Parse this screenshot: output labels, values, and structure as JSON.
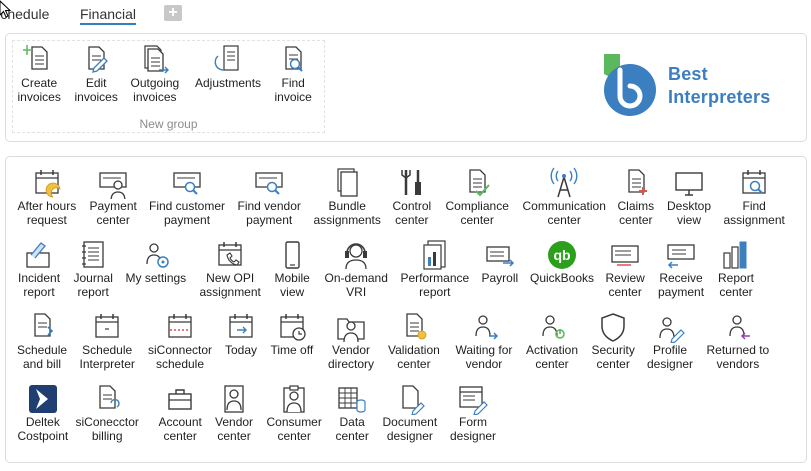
{
  "tabs": [
    {
      "label": "Schedule",
      "active": false
    },
    {
      "label": "Financial",
      "active": true
    }
  ],
  "add_tab_label": "+",
  "logo": {
    "line1": "Best",
    "line2": "Interpreters",
    "green": "#5cb85c",
    "blue": "#3b7fc1"
  },
  "group1": {
    "name": "New group",
    "items": [
      {
        "label": "Create\ninvoices",
        "icon": "create-invoice-icon"
      },
      {
        "label": "Edit\ninvoices",
        "icon": "edit-invoice-icon"
      },
      {
        "label": "Outgoing\ninvoices",
        "icon": "outgoing-invoices-icon"
      },
      {
        "label": "Adjustments",
        "icon": "adjustments-icon"
      },
      {
        "label": "Find\ninvoice",
        "icon": "find-invoice-icon"
      }
    ]
  },
  "main": {
    "rows": [
      [
        {
          "label": "After hours\nrequest",
          "icon": "after-hours-icon"
        },
        {
          "label": "Payment\ncenter",
          "icon": "payment-center-icon"
        },
        {
          "label": "Find customer\npayment",
          "icon": "find-customer-payment-icon"
        },
        {
          "label": "Find vendor\npayment",
          "icon": "find-vendor-payment-icon"
        },
        {
          "label": "Bundle\nassignments",
          "icon": "bundle-icon"
        },
        {
          "label": "Control\ncenter",
          "icon": "tools-icon"
        },
        {
          "label": "Compliance\ncenter",
          "icon": "compliance-icon"
        },
        {
          "label": "Communication\ncenter",
          "icon": "antenna-icon"
        },
        {
          "label": "Claims\ncenter",
          "icon": "claims-icon"
        },
        {
          "label": "Desktop\nview",
          "icon": "monitor-icon"
        },
        {
          "label": "Find\nassignment",
          "icon": "find-assignment-icon"
        }
      ],
      [
        {
          "label": "Incident\nreport",
          "icon": "incident-icon"
        },
        {
          "label": "Journal\nreport",
          "icon": "journal-icon"
        },
        {
          "label": "My settings",
          "icon": "user-settings-icon"
        },
        {
          "label": "New OPI\nassignment",
          "icon": "new-opi-icon"
        },
        {
          "label": "Mobile\nview",
          "icon": "mobile-icon"
        },
        {
          "label": "On-demand\nVRI",
          "icon": "headset-icon"
        },
        {
          "label": "Performance\nreport",
          "icon": "performance-icon"
        },
        {
          "label": "Payroll",
          "icon": "payroll-icon"
        },
        {
          "label": "QuickBooks",
          "icon": "quickbooks-icon"
        },
        {
          "label": "Review\ncenter",
          "icon": "review-icon"
        },
        {
          "label": "Receive\npayment",
          "icon": "receive-payment-icon"
        },
        {
          "label": "Report\ncenter",
          "icon": "report-chart-icon"
        }
      ],
      [
        {
          "label": "Schedule\nand bill",
          "icon": "schedule-bill-icon"
        },
        {
          "label": "Schedule\nInterpreter",
          "icon": "schedule-interpreter-icon"
        },
        {
          "label": "siConnector\nschedule",
          "icon": "siconnector-schedule-icon"
        },
        {
          "label": "Today",
          "icon": "today-icon"
        },
        {
          "label": "Time off",
          "icon": "time-off-icon"
        },
        {
          "label": "Vendor\ndirectory",
          "icon": "vendor-directory-icon"
        },
        {
          "label": "Validation\ncenter",
          "icon": "validation-icon"
        },
        {
          "label": "Waiting for\nvendor",
          "icon": "waiting-vendor-icon"
        },
        {
          "label": "Activation\ncenter",
          "icon": "activation-icon"
        },
        {
          "label": "Security\ncenter",
          "icon": "shield-icon"
        },
        {
          "label": "Profile\ndesigner",
          "icon": "profile-designer-icon"
        },
        {
          "label": "Returned to\nvendors",
          "icon": "returned-vendors-icon"
        }
      ],
      [
        {
          "label": "Deltek\nCostpoint",
          "icon": "deltek-icon"
        },
        {
          "label": "siConecctor\nbilling",
          "icon": "siconnector-billing-icon"
        },
        {
          "label": "Account\ncenter",
          "icon": "briefcase-icon"
        },
        {
          "label": "Vendor\ncenter",
          "icon": "vendor-badge-icon"
        },
        {
          "label": "Consumer\ncenter",
          "icon": "consumer-clipboard-icon"
        },
        {
          "label": "Data\ncenter",
          "icon": "data-center-icon"
        },
        {
          "label": "Document\ndesigner",
          "icon": "document-designer-icon"
        },
        {
          "label": "Form\ndesigner",
          "icon": "form-designer-icon"
        }
      ]
    ]
  }
}
